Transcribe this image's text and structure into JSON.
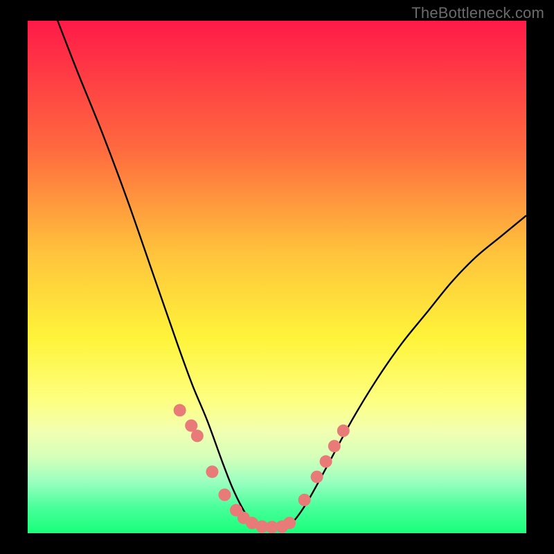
{
  "watermark": "TheBottleneck.com",
  "chart_data": {
    "type": "line",
    "title": "",
    "xlabel": "",
    "ylabel": "",
    "xlim": [
      0,
      100
    ],
    "ylim": [
      0,
      100
    ],
    "grid": false,
    "legend": false,
    "series": [
      {
        "name": "bottleneck-curve",
        "x": [
          6,
          10,
          15,
          20,
          25,
          30,
          33,
          36,
          39,
          41,
          43,
          45,
          47,
          49,
          51,
          53,
          56,
          60,
          65,
          70,
          75,
          80,
          85,
          90,
          95,
          100
        ],
        "y": [
          100,
          90,
          78,
          65,
          51,
          37,
          29,
          22,
          14,
          9,
          5,
          2,
          1,
          1,
          1,
          2,
          6,
          13,
          22,
          30,
          37,
          43,
          49,
          54,
          58,
          62
        ]
      }
    ],
    "markers": {
      "name": "highlight-dots",
      "color": "#e87a78",
      "radius_px": 9,
      "x": [
        30.5,
        32.8,
        34.0,
        37.0,
        39.5,
        41.8,
        43.3,
        45.0,
        47.0,
        49.0,
        51.0,
        52.5,
        55.5,
        58.0,
        59.8,
        61.5,
        63.3
      ],
      "y": [
        24.0,
        21.0,
        19.0,
        12.0,
        7.5,
        4.5,
        3.0,
        2.0,
        1.3,
        1.2,
        1.3,
        2.0,
        6.5,
        11.0,
        14.0,
        17.0,
        20.0
      ]
    },
    "gradient_stops": [
      {
        "pos": 0.0,
        "color": "#ff1a48"
      },
      {
        "pos": 0.25,
        "color": "#ff6a3f"
      },
      {
        "pos": 0.45,
        "color": "#ffc23c"
      },
      {
        "pos": 0.62,
        "color": "#fff43a"
      },
      {
        "pos": 0.74,
        "color": "#fdff80"
      },
      {
        "pos": 0.8,
        "color": "#f2ffb0"
      },
      {
        "pos": 0.85,
        "color": "#d6ffba"
      },
      {
        "pos": 0.9,
        "color": "#99ffc0"
      },
      {
        "pos": 0.95,
        "color": "#48ff9a"
      },
      {
        "pos": 1.0,
        "color": "#18ff7a"
      }
    ]
  }
}
